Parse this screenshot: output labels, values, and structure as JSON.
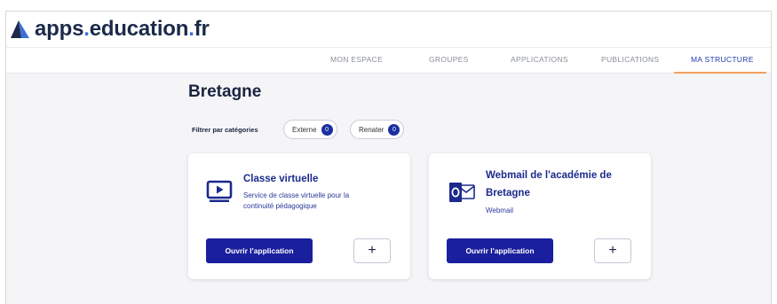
{
  "brand": {
    "name_part1": "apps",
    "dot1": ".",
    "name_part2": "education",
    "dot2": ".",
    "name_part3": "fr"
  },
  "nav": {
    "items": [
      {
        "label": "MON ESPACE",
        "active": false
      },
      {
        "label": "GROUPES",
        "active": false
      },
      {
        "label": "APPLICATIONS",
        "active": false
      },
      {
        "label": "PUBLICATIONS",
        "active": false
      },
      {
        "label": "MA STRUCTURE",
        "active": true
      }
    ]
  },
  "page": {
    "title": "Bretagne"
  },
  "filters": {
    "label": "Filtrer par catégories",
    "chips": [
      {
        "label": "Externe",
        "count": "0"
      },
      {
        "label": "Renater",
        "count": "0"
      }
    ]
  },
  "cards": [
    {
      "title": "Classe virtuelle",
      "description_line1": "Service de classe virtuelle pour la",
      "description_line2": "continuité pédagogique",
      "icon": "video-screen-icon",
      "open_label": "Ouvrir l'application",
      "plus_label": "+"
    },
    {
      "title_line1": "Webmail de l'académie de",
      "title_line2": "Bretagne",
      "description": "Webmail",
      "icon": "outlook-mail-icon",
      "open_label": "Ouvrir l'application",
      "plus_label": "+"
    }
  ],
  "colors": {
    "accent": "#1a1f9e",
    "nav_active": "#1f3aa8",
    "underline": "#f0a060",
    "background": "#f5f5f8"
  }
}
